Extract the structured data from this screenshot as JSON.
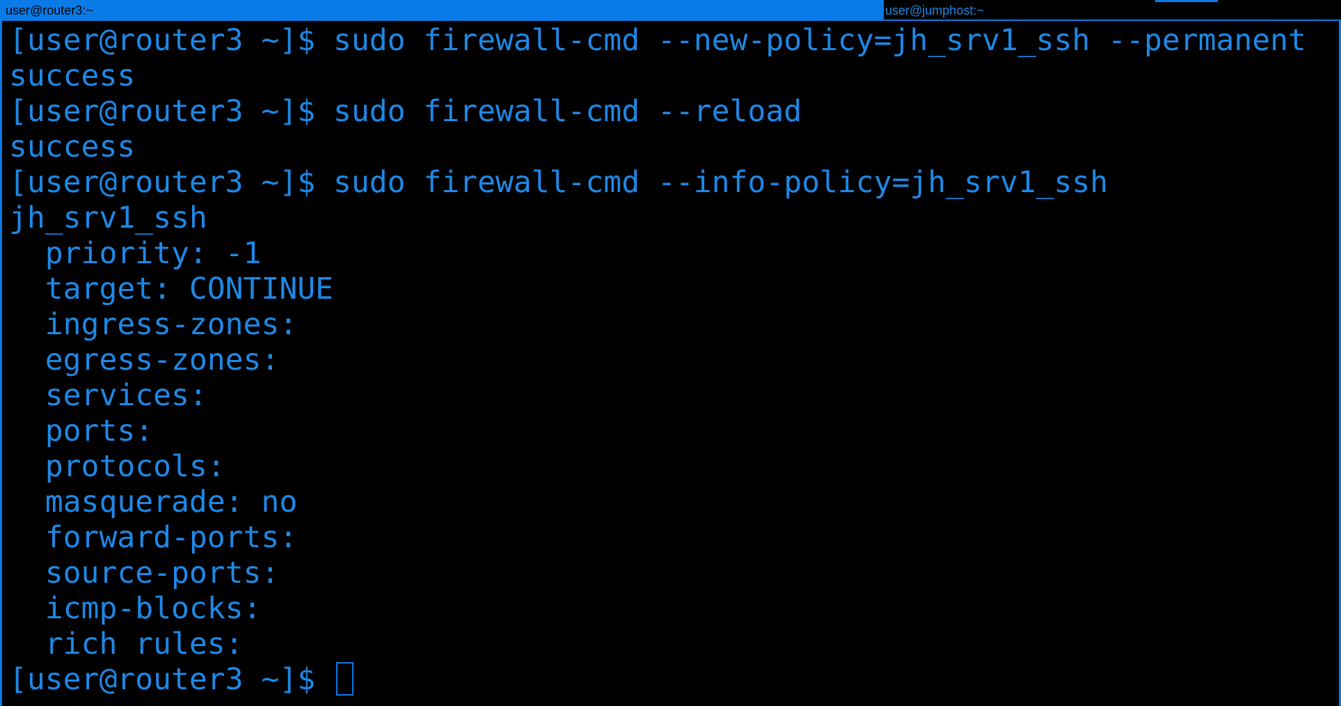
{
  "tabs": {
    "active_title": "user@router3:~",
    "inactive_title": "user@jumphost:~"
  },
  "terminal": {
    "lines": [
      "[user@router3 ~]$ sudo firewall-cmd --new-policy=jh_srv1_ssh --permanent",
      "success",
      "[user@router3 ~]$ sudo firewall-cmd --reload",
      "success",
      "[user@router3 ~]$ sudo firewall-cmd --info-policy=jh_srv1_ssh",
      "jh_srv1_ssh",
      "  priority: -1",
      "  target: CONTINUE",
      "  ingress-zones: ",
      "  egress-zones: ",
      "  services: ",
      "  ports: ",
      "  protocols: ",
      "  masquerade: no",
      "  forward-ports: ",
      "  source-ports: ",
      "  icmp-blocks: ",
      "  rich rules: "
    ],
    "prompt": "[user@router3 ~]$ "
  },
  "colors": {
    "accent": "#0a7ae6",
    "text": "#1e88e5",
    "background": "#000000"
  }
}
